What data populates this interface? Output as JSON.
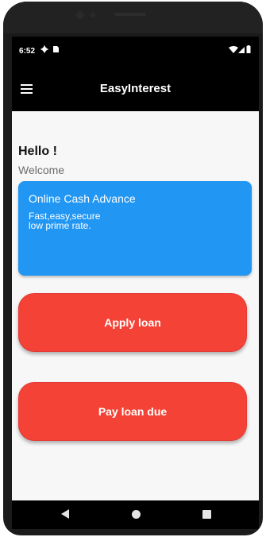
{
  "status_bar": {
    "time": "6:52"
  },
  "app_bar": {
    "title": "EasyInterest",
    "menu_icon": "hamburger-menu-icon"
  },
  "content": {
    "greeting": "Hello !",
    "welcome": "Welcome",
    "promo_card": {
      "title": "Online Cash Advance",
      "subtitle": "Fast,easy,secure\nlow prime rate."
    },
    "apply_button": "Apply loan",
    "pay_button": "Pay loan due"
  },
  "nav_bar": {
    "back_icon": "back-triangle-icon",
    "home_icon": "home-circle-icon",
    "recents_icon": "recents-square-icon"
  },
  "colors": {
    "app_bar": "#000000",
    "promo_card": "#2196f3",
    "buttons": "#f44336",
    "background": "#f7f7f7"
  }
}
